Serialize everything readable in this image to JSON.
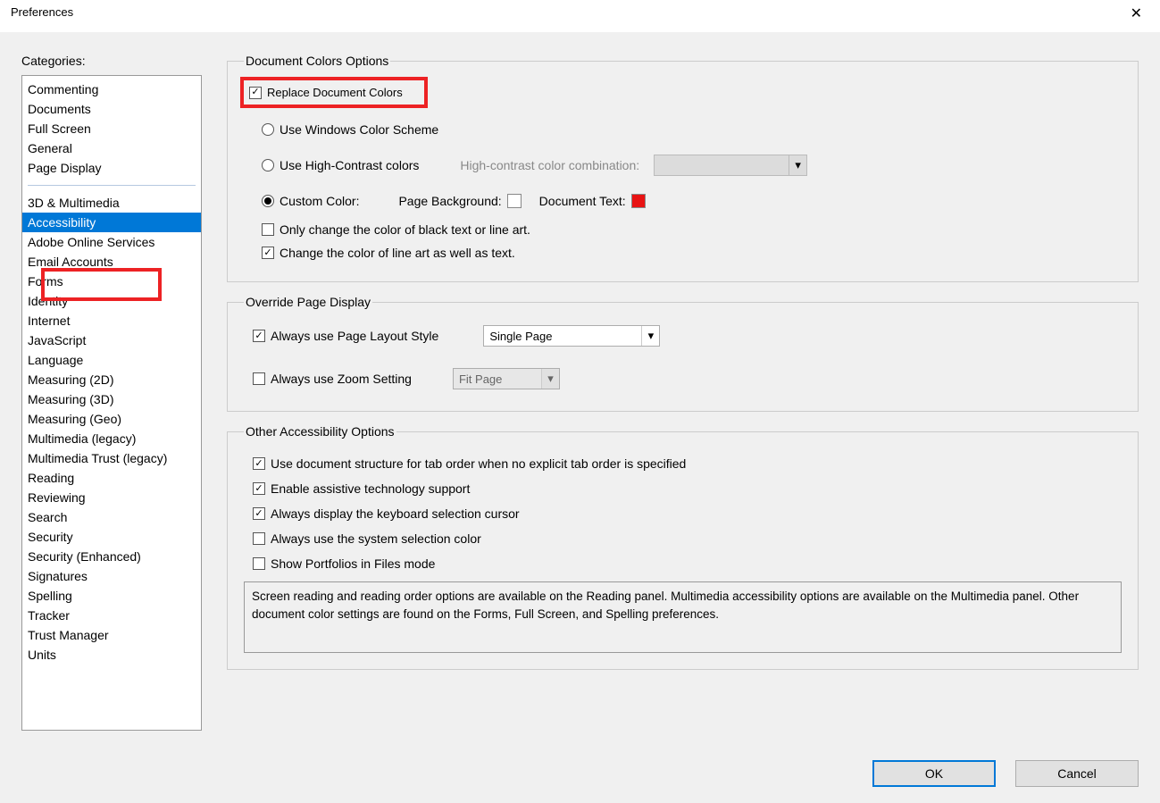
{
  "title": "Preferences",
  "close": "✕",
  "sidebar": {
    "heading": "Categories:",
    "top": [
      "Commenting",
      "Documents",
      "Full Screen",
      "General",
      "Page Display"
    ],
    "bottom": [
      "3D & Multimedia",
      "Accessibility",
      "Adobe Online Services",
      "Email Accounts",
      "Forms",
      "Identity",
      "Internet",
      "JavaScript",
      "Language",
      "Measuring (2D)",
      "Measuring (3D)",
      "Measuring (Geo)",
      "Multimedia (legacy)",
      "Multimedia Trust (legacy)",
      "Reading",
      "Reviewing",
      "Search",
      "Security",
      "Security (Enhanced)",
      "Signatures",
      "Spelling",
      "Tracker",
      "Trust Manager",
      "Units"
    ],
    "selected": "Accessibility"
  },
  "groups": {
    "doc_colors": {
      "legend": "Document Colors Options",
      "replace": "Replace Document Colors",
      "use_windows": "Use Windows Color Scheme",
      "use_hc": "Use High-Contrast colors",
      "hc_combo_label": "High-contrast color combination:",
      "custom_color": "Custom Color:",
      "page_bg": "Page Background:",
      "doc_text": "Document Text:",
      "only_black": "Only change the color of black text or line art.",
      "change_lineart": "Change the color of line art as well as text."
    },
    "override": {
      "legend": "Override Page Display",
      "layout": "Always use Page Layout Style",
      "layout_value": "Single Page",
      "zoom": "Always use Zoom Setting",
      "zoom_value": "Fit Page"
    },
    "other": {
      "legend": "Other Accessibility Options",
      "tab_order": "Use document structure for tab order when no explicit tab order is specified",
      "assistive": "Enable assistive technology support",
      "kb_cursor": "Always display the keyboard selection cursor",
      "sys_color": "Always use the system selection color",
      "portfolios": "Show Portfolios in Files mode",
      "info": "Screen reading and reading order options are available on the Reading panel. Multimedia accessibility options are available on the Multimedia panel. Other document color settings are found on the Forms, Full Screen, and Spelling preferences."
    }
  },
  "footer": {
    "ok": "OK",
    "cancel": "Cancel"
  }
}
